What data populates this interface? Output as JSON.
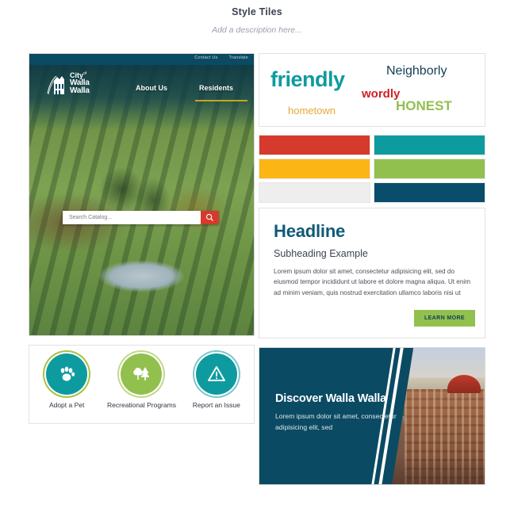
{
  "page": {
    "title": "Style Tiles",
    "description": "Add a description here..."
  },
  "site_mockup": {
    "topbar": {
      "contact_label": "Contact Us",
      "translate_label": "Translate"
    },
    "logo": {
      "line1": "City",
      "line1_sup": "of",
      "line2": "Walla",
      "line3": "Walla"
    },
    "nav": [
      {
        "label": "About Us",
        "active": false
      },
      {
        "label": "Residents",
        "active": true
      }
    ],
    "search": {
      "placeholder": "Search Catalog...",
      "value": "",
      "button_icon": "search-icon",
      "button_color": "#d63a2c"
    }
  },
  "quick_links": [
    {
      "label": "Adopt a Pet",
      "icon": "paw-icon",
      "color": "#0e9ba0",
      "ring": "ring-gold"
    },
    {
      "label": "Recreational Programs",
      "icon": "trees-icon",
      "color": "#92c04f",
      "ring": "ring-green"
    },
    {
      "label": "Report an Issue",
      "icon": "warning-triangle-icon",
      "color": "#0e9ba0",
      "ring": "ring-teal"
    }
  ],
  "adjectives": [
    {
      "text": "friendly",
      "color": "#0e9ba0"
    },
    {
      "text": "Neighborly",
      "color": "#143e52"
    },
    {
      "text": "wordly",
      "color": "#cf2026"
    },
    {
      "text": "hometown",
      "color": "#eaa833"
    },
    {
      "text": "HONEST",
      "color": "#92c04f"
    }
  ],
  "swatches": [
    {
      "name": "red",
      "hex": "#d63a2c"
    },
    {
      "name": "teal",
      "hex": "#0e9ba0"
    },
    {
      "name": "gold",
      "hex": "#fbb515"
    },
    {
      "name": "green",
      "hex": "#92c04f"
    },
    {
      "name": "light-gray",
      "hex": "#eeeeee"
    },
    {
      "name": "navy",
      "hex": "#094d6b"
    }
  ],
  "typography": {
    "headline": "Headline",
    "subheading": "Subheading Example",
    "body": "Lorem ipsum dolor sit amet, consectetur adipisicing elit, sed do eiusmod tempor incididunt ut labore et dolore magna aliqua. Ut enim ad minim veniam, quis nostrud exercitation ullamco laboris nisi ut",
    "button_label": "LEARN MORE"
  },
  "discover_card": {
    "title": "Discover Walla Walla",
    "body": "Lorem ipsum dolor sit amet, consectetur adipisicing elit, sed",
    "background_color": "#0b4a63"
  }
}
